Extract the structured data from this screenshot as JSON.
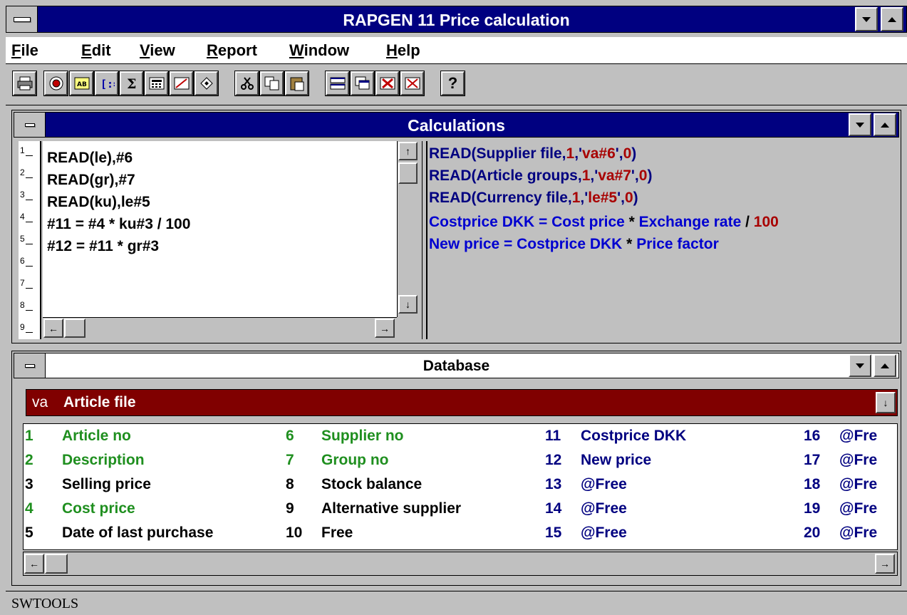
{
  "window": {
    "title": "RAPGEN 11 Price calculation"
  },
  "menu": {
    "items": [
      {
        "u": "F",
        "rest": "ile"
      },
      {
        "u": "E",
        "rest": "dit"
      },
      {
        "u": "V",
        "rest": "iew"
      },
      {
        "u": "R",
        "rest": "eport"
      },
      {
        "u": "W",
        "rest": "indow"
      },
      {
        "u": "H",
        "rest": "elp"
      }
    ]
  },
  "toolbar": {
    "help_glyph": "?"
  },
  "calculations": {
    "title": "Calculations",
    "line_numbers": [
      "1",
      "2",
      "3",
      "4",
      "5",
      "6",
      "7",
      "8",
      "9"
    ],
    "code_lines": [
      "READ(le),#6",
      "READ(gr),#7",
      "READ(ku),le#5",
      "#11 = #4 * ku#3 / 100",
      "#12 = #11 * gr#3"
    ],
    "explain": [
      {
        "a": "READ(Supplier file,",
        "b": "1",
        "c": ",'",
        "d": "va#6",
        "e": "',",
        "f": "0",
        "g": ")"
      },
      {
        "a": "READ(Article groups,",
        "b": "1",
        "c": ",'",
        "d": "va#7",
        "e": "',",
        "f": "0",
        "g": ")"
      },
      {
        "a": "READ(Currency file,",
        "b": "1",
        "c": ",'",
        "d": "le#5",
        "e": "',",
        "f": "0",
        "g": ")"
      }
    ],
    "formula1": {
      "lhs": "Costprice DKK = Cost price ",
      "op1": "*",
      "mid": " Exchange rate ",
      "op2": "/",
      "num": "100"
    },
    "formula2": {
      "lhs": "New price = Costprice DKK ",
      "op1": "*",
      "rhs": " Price factor"
    }
  },
  "database": {
    "title": "Database",
    "selected_code": "va",
    "selected_name": "Article file",
    "columns": [
      [
        {
          "num": "1",
          "name": "Article no",
          "color": "green"
        },
        {
          "num": "2",
          "name": "Description",
          "color": "green"
        },
        {
          "num": "3",
          "name": "Selling price",
          "color": "black"
        },
        {
          "num": "4",
          "name": "Cost price",
          "color": "green"
        },
        {
          "num": "5",
          "name": "Date of last purchase",
          "color": "black"
        }
      ],
      [
        {
          "num": "6",
          "name": "Supplier no",
          "color": "green"
        },
        {
          "num": "7",
          "name": "Group no",
          "color": "green"
        },
        {
          "num": "8",
          "name": "Stock balance",
          "color": "black"
        },
        {
          "num": "9",
          "name": "Alternative supplier",
          "color": "black"
        },
        {
          "num": "10",
          "name": "Free",
          "color": "black"
        }
      ],
      [
        {
          "num": "11",
          "name": "Costprice DKK",
          "color": "navy"
        },
        {
          "num": "12",
          "name": "New price",
          "color": "navy"
        },
        {
          "num": "13",
          "name": "@Free",
          "color": "navy"
        },
        {
          "num": "14",
          "name": "@Free",
          "color": "navy"
        },
        {
          "num": "15",
          "name": "@Free",
          "color": "navy"
        }
      ],
      [
        {
          "num": "16",
          "name": "@Fre",
          "color": "navy"
        },
        {
          "num": "17",
          "name": "@Fre",
          "color": "navy"
        },
        {
          "num": "18",
          "name": "@Fre",
          "color": "navy"
        },
        {
          "num": "19",
          "name": "@Fre",
          "color": "navy"
        },
        {
          "num": "20",
          "name": "@Fre",
          "color": "navy"
        }
      ]
    ]
  },
  "status": {
    "text": "SWTOOLS"
  },
  "colors": {
    "titlebar_active": "#000080",
    "selected_file_bg": "#800000",
    "field_green": "#1f8f1f",
    "field_navy": "#000080",
    "value_red": "#a80000"
  }
}
